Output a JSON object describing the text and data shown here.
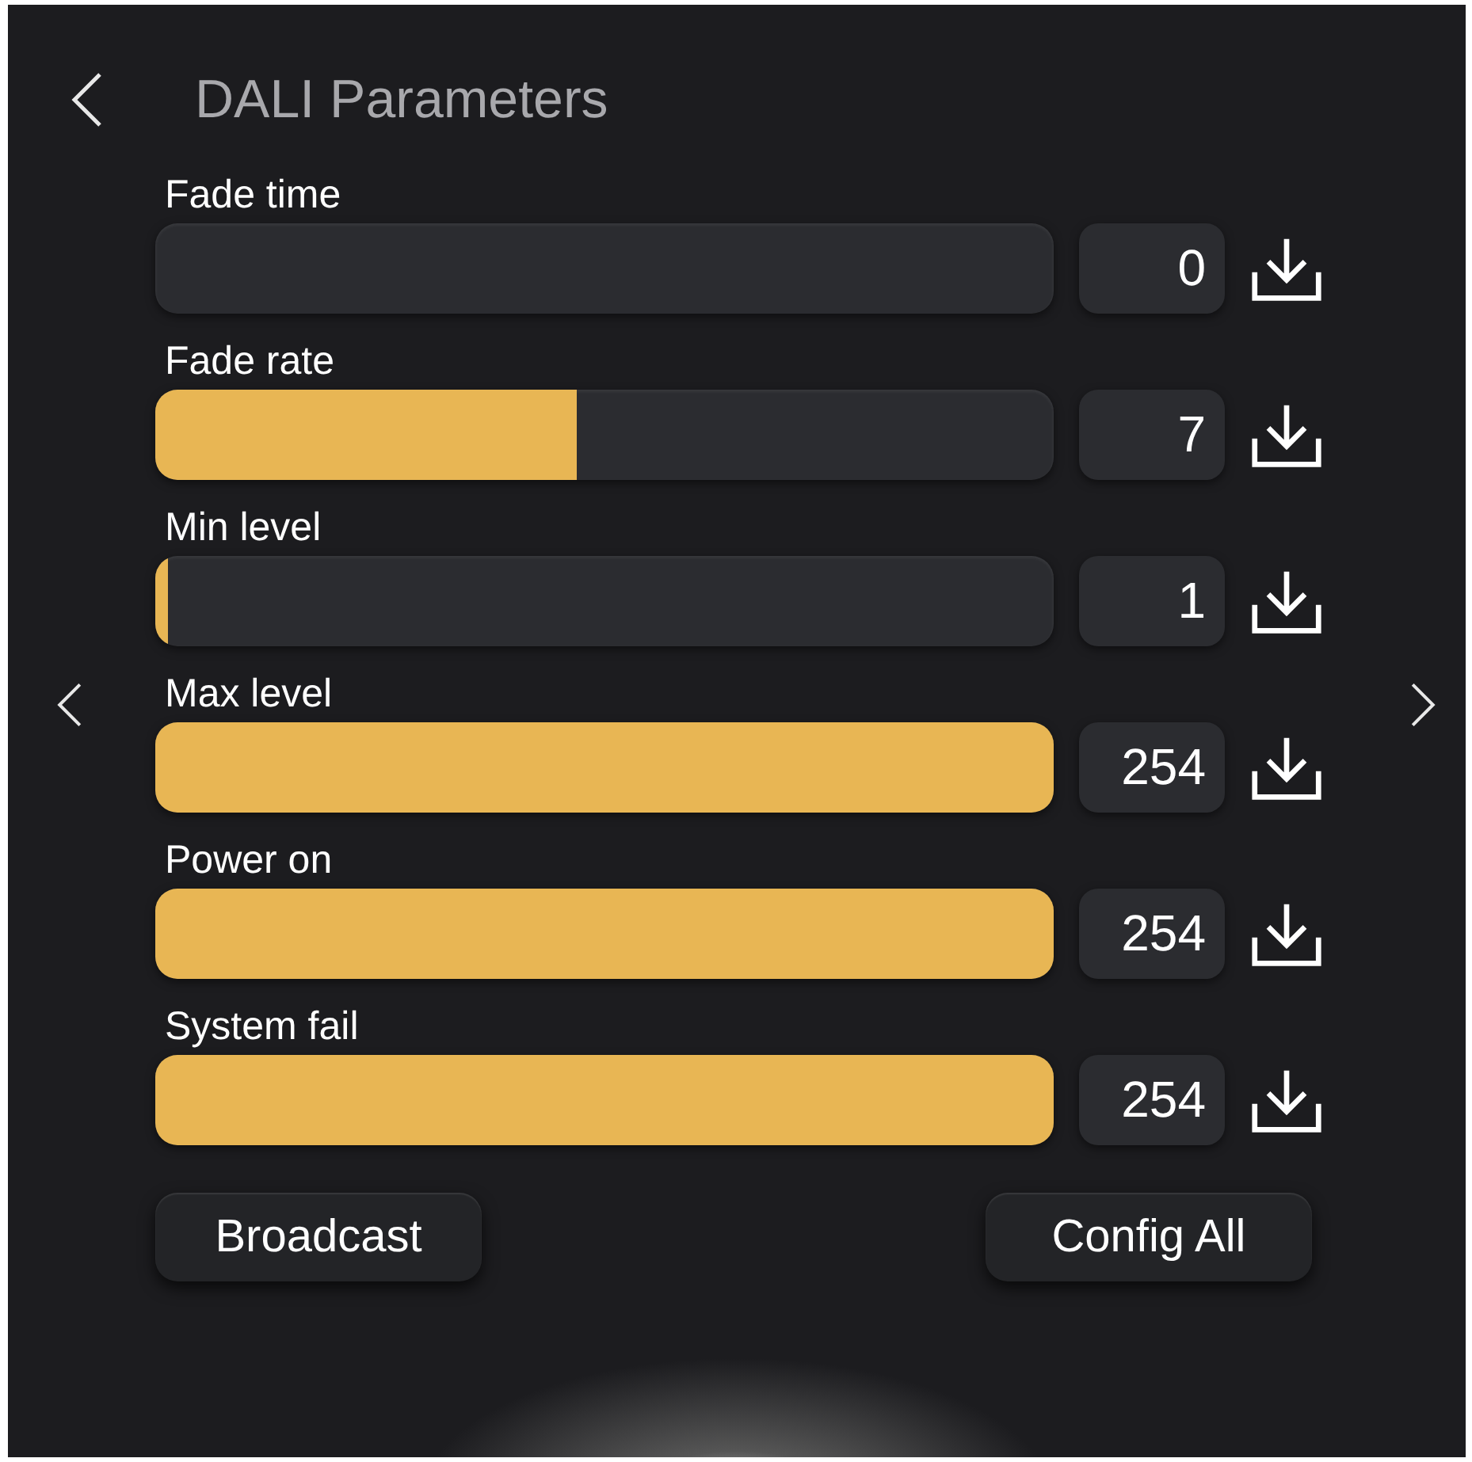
{
  "header": {
    "title": "DALI Parameters"
  },
  "parameters": [
    {
      "label": "Fade time",
      "level": 0,
      "value": "0"
    },
    {
      "label": "Fade rate",
      "level": 0.47,
      "value": "7"
    },
    {
      "label": "Min level",
      "level": 0.014,
      "value": "1"
    },
    {
      "label": "Max level",
      "level": 1,
      "value": "254"
    },
    {
      "label": "Power on",
      "level": 1,
      "value": "254"
    },
    {
      "label": "System fail",
      "level": 1,
      "value": "254"
    }
  ],
  "buttons": [
    {
      "label": "Broadcast"
    },
    {
      "label": "Config All"
    }
  ]
}
